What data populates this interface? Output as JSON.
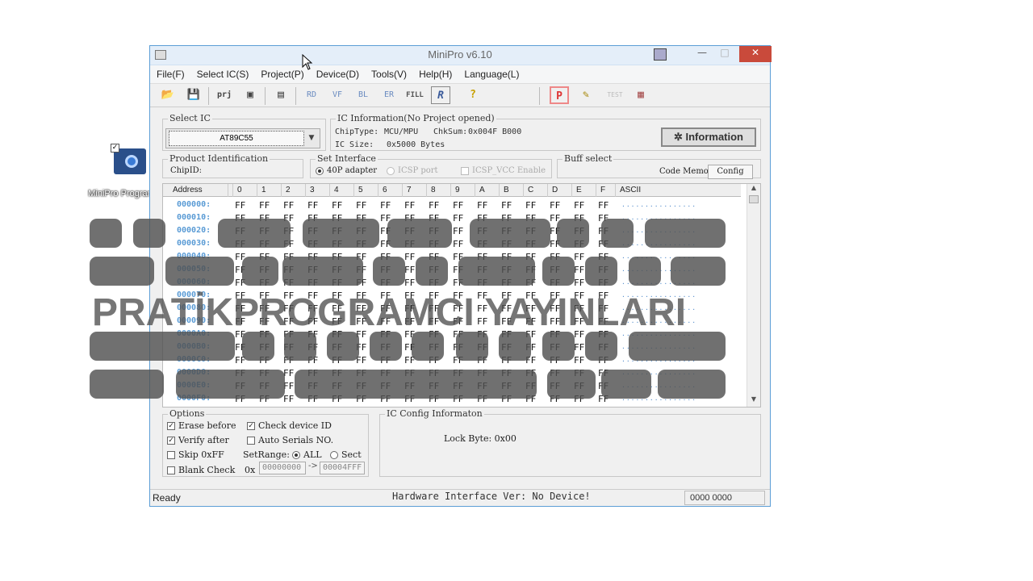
{
  "desktop": {
    "icon_label": "MiniPro Programmer"
  },
  "window": {
    "title": "MiniPro v6.10",
    "min": "—",
    "max": "□",
    "close": "✕"
  },
  "menu": [
    "File(F)",
    "Select IC(S)",
    "Project(P)",
    "Device(D)",
    "Tools(V)",
    "Help(H)",
    "Language(L)"
  ],
  "toolbar": {
    "open": "📂",
    "save": "💾",
    "prj": "prj",
    "saveas": "▣",
    "memo": "▤",
    "read": "RD",
    "verify": "VF",
    "blank": "BL",
    "erase": "ER",
    "fill": "FILL",
    "r": "R",
    "help": "?",
    "p": "P",
    "edit": "✎",
    "test": "TEST",
    "chip": "▦"
  },
  "select_ic": {
    "legend": "Select IC",
    "value": "AT89C55"
  },
  "ic_info": {
    "legend": "IC Information(No Project opened)",
    "chip_type_label": "ChipType:",
    "chip_type": "MCU/MPU",
    "checksum_label": "ChkSum:",
    "checksum": "0x004F B000",
    "size_label": "IC Size:",
    "size": "0x5000 Bytes",
    "button": "Information"
  },
  "product_id": {
    "legend": "Product Identification",
    "chipid_label": "ChipID:"
  },
  "interface": {
    "legend": "Set Interface",
    "opt1": "40P adapter",
    "opt2": "ICSP port",
    "opt3": "ICSP_VCC Enable"
  },
  "buff": {
    "legend": "Buff select",
    "code_memo": "Code Memo",
    "config": "Config"
  },
  "grid": {
    "address_header": "Address",
    "columns": [
      "0",
      "1",
      "2",
      "3",
      "4",
      "5",
      "6",
      "7",
      "8",
      "9",
      "A",
      "B",
      "C",
      "D",
      "E",
      "F"
    ],
    "ascii_header": "ASCII",
    "cell": "FF",
    "ascii": "................",
    "rows": [
      "000000:",
      "000010:",
      "000020:",
      "000030:",
      "000040:",
      "000050:",
      "000060:",
      "000070:",
      "000080:",
      "000090:",
      "0000A0:",
      "0000B0:",
      "0000C0:",
      "0000D0:",
      "0000E0:",
      "0000F0:"
    ]
  },
  "options": {
    "legend": "Options",
    "erase_before": "Erase before",
    "verify_after": "Verify after",
    "skip_ff": "Skip 0xFF",
    "blank_check": "Blank Check",
    "check_device_id": "Check device ID",
    "auto_serials": "Auto Serials NO.",
    "set_range": "SetRange:",
    "all": "ALL",
    "sect": "Sect",
    "ox": "0x",
    "range_start": "00000000",
    "range_arrow": "->",
    "range_end": "00004FFF"
  },
  "ic_config": {
    "legend": "IC Config Informaton",
    "lock_byte": "Lock Byte: 0x00"
  },
  "status": {
    "left": "Ready",
    "middle": "Hardware Interface Ver: No Device!",
    "right": "0000 0000"
  },
  "watermark": {
    "text": "PRATİKPROGRAMCI YAYINLARI"
  }
}
